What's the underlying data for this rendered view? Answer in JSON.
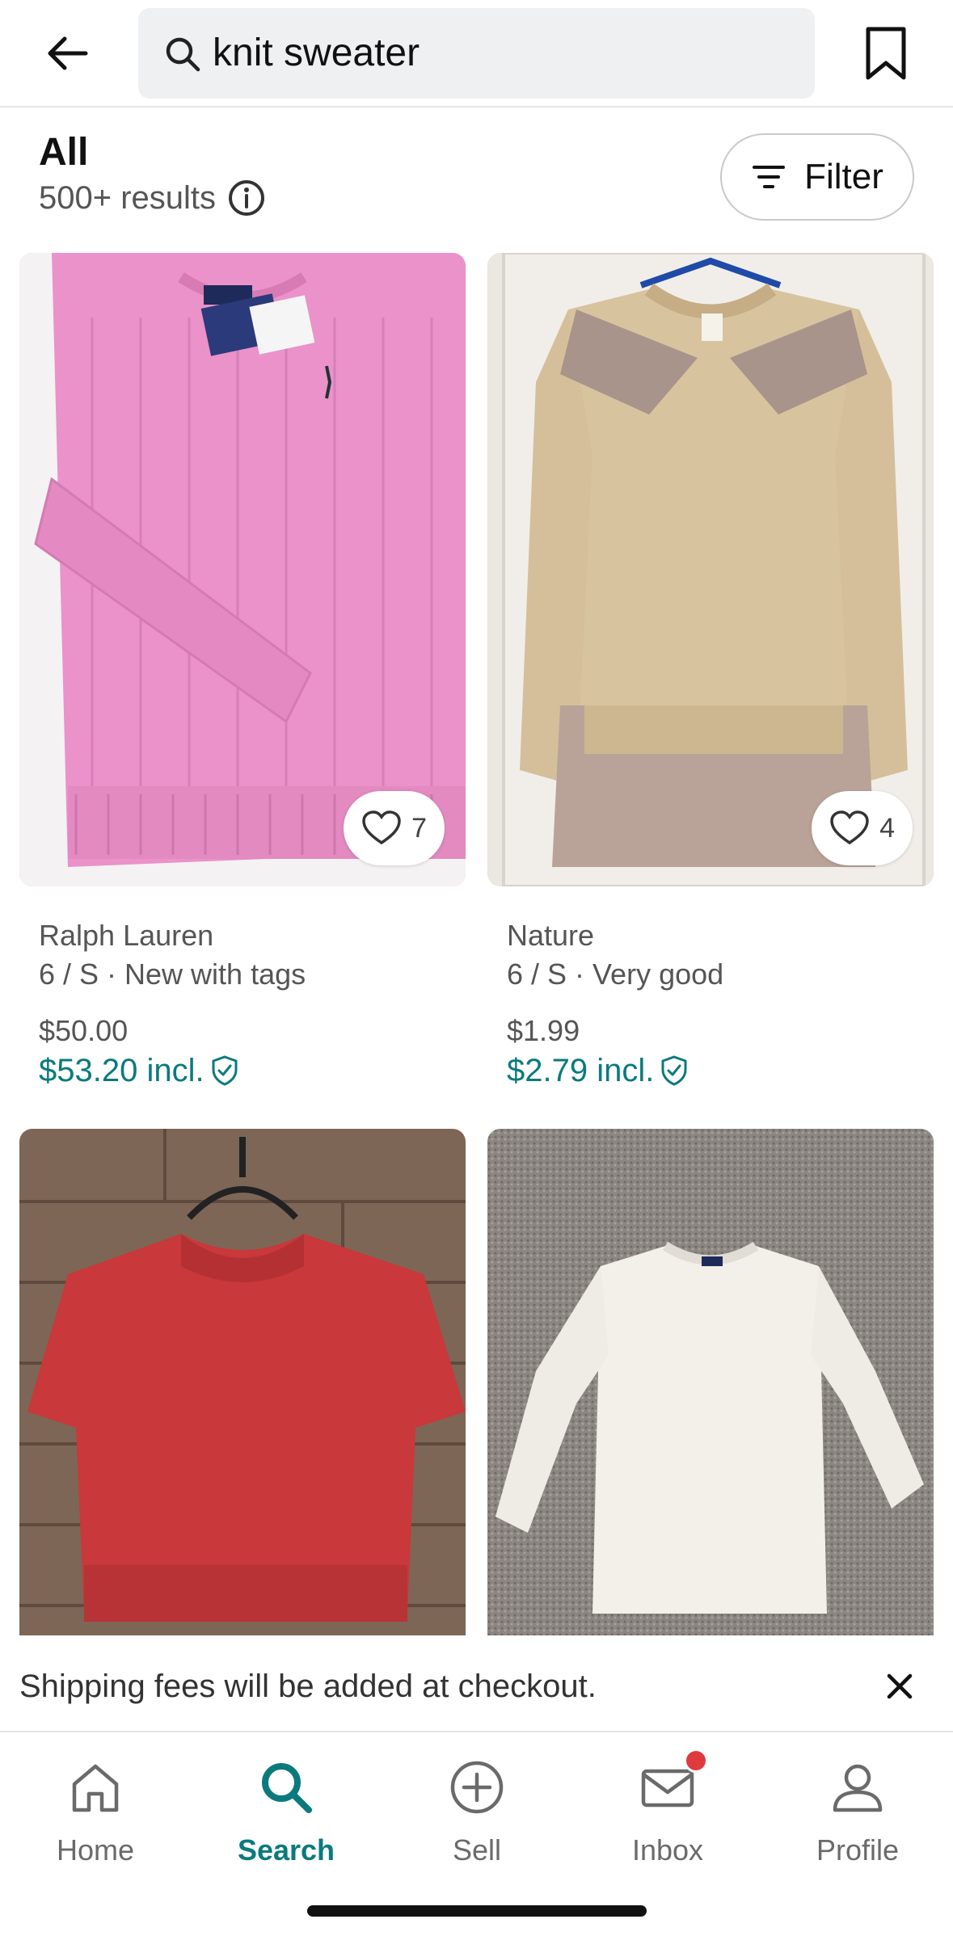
{
  "search": {
    "query": "knit sweater"
  },
  "results": {
    "title": "All",
    "count": "500+ results",
    "filter_label": "Filter"
  },
  "products": [
    {
      "brand": "Ralph Lauren",
      "meta": "6 / S · New with tags",
      "price": "$50.00",
      "price_incl": "$53.20 incl.",
      "likes": "7",
      "image_color": "#e98fc6"
    },
    {
      "brand": "Nature",
      "meta": "6 / S · Very good",
      "price": "$1.99",
      "price_incl": "$2.79 incl.",
      "likes": "4",
      "image_color": "#d7c3a3"
    },
    {
      "image_color": "#c43a3a"
    },
    {
      "image_color": "#f2efe9"
    }
  ],
  "shipping_banner": {
    "text": "Shipping fees will be added at checkout."
  },
  "nav": {
    "items": [
      {
        "label": "Home",
        "icon": "home-icon"
      },
      {
        "label": "Search",
        "icon": "search-icon",
        "active": true
      },
      {
        "label": "Sell",
        "icon": "plus-circle-icon"
      },
      {
        "label": "Inbox",
        "icon": "mail-icon",
        "badge": true
      },
      {
        "label": "Profile",
        "icon": "person-icon"
      }
    ]
  },
  "colors": {
    "accent": "#0b7a7d",
    "badge": "#e0393e"
  }
}
